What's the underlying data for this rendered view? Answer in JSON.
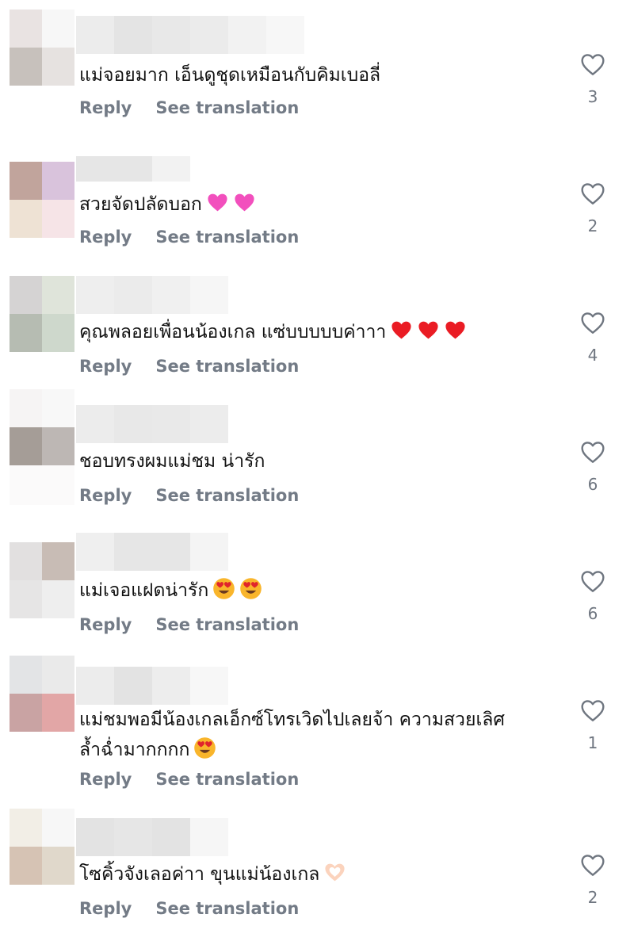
{
  "comments": [
    {
      "text": "แม่จอยมาก เอ็นดูชุดเหมือนกับคิมเบอลี่",
      "reply_label": "Reply",
      "translate_label": "See translation",
      "likes": "3",
      "avatar_colors": [
        "#e9e3e2",
        "#f7f7f7",
        "#c7c1bc",
        "#e6e2e0"
      ],
      "name_colors": [
        "#ececec",
        "#e4e4e4",
        "#e8e8e8",
        "#ebebeb",
        "#f2f2f2",
        "#f7f7f7"
      ]
    },
    {
      "text": "สวยจัดปลัดบอก",
      "emoji": [
        "pink-heart",
        "pink-heart"
      ],
      "reply_label": "Reply",
      "translate_label": "See translation",
      "likes": "2",
      "avatar_colors": [
        "#c1a49c",
        "#d9c3dc",
        "#eee2d4",
        "#f6e4e7"
      ],
      "name_colors": [
        "#e6e6e6",
        "#e6e6e6",
        "#f2f2f2"
      ]
    },
    {
      "text": "คุณพลอยเพื่อนน้องเกล แซ่บบบบบค่าาา",
      "emoji": [
        "red-heart",
        "red-heart",
        "red-heart"
      ],
      "reply_label": "Reply",
      "translate_label": "See translation",
      "likes": "4",
      "avatar_colors": [
        "#d5d3d3",
        "#dfe4da",
        "#b6bcb2",
        "#ced8cc"
      ],
      "name_colors": [
        "#eeeeee",
        "#ebebeb",
        "#f0f0f0",
        "#f6f6f6"
      ]
    },
    {
      "text": "ชอบทรงผมแม่ชม น่ารัก",
      "reply_label": "Reply",
      "translate_label": "See translation",
      "likes": "6",
      "avatar_colors": [
        "#f6f4f4",
        "#f8f8f8",
        "#a59d97",
        "#bdb7b4"
      ],
      "name_colors": [
        "#ececec",
        "#e8e8e8",
        "#e9e9e9",
        "#ececec"
      ]
    },
    {
      "text": "แม่เจอแฝดน่ารัก",
      "emoji": [
        "heart-eyes",
        "heart-eyes"
      ],
      "reply_label": "Reply",
      "translate_label": "See translation",
      "likes": "6",
      "avatar_colors": [
        "#e2e0e0",
        "#c8bcb5",
        "#e6e5e5",
        "#eeeeee"
      ],
      "name_colors": [
        "#efefef",
        "#e6e6e6",
        "#e6e6e6",
        "#f4f4f4"
      ]
    },
    {
      "text": "แม่ชมพอมีน้องเกลเอ็กซ์โทรเวิดไปเลยจ้า ความสวยเลิศ",
      "text2": "ล้ำฉ่ำมากกกก",
      "emoji2": [
        "heart-eyes"
      ],
      "reply_label": "Reply",
      "translate_label": "See translation",
      "likes": "1",
      "avatar_colors": [
        "#e3e4e6",
        "#eaeaea",
        "#c9a3a3",
        "#e2a6a6"
      ],
      "name_colors": [
        "#ececec",
        "#e3e3e3",
        "#ededed",
        "#f7f7f7"
      ]
    },
    {
      "text": "โซคิ้วจังเลอค่าา ขุนแม่น้องเกล",
      "emoji": [
        "heart-hands"
      ],
      "reply_label": "Reply",
      "translate_label": "See translation",
      "likes": "2",
      "avatar_colors": [
        "#f2eee6",
        "#f7f7f7",
        "#d6c3b4",
        "#e0d8cb"
      ],
      "name_colors": [
        "#e3e3e3",
        "#e6e6e6",
        "#e3e3e3",
        "#f6f6f6"
      ]
    }
  ]
}
